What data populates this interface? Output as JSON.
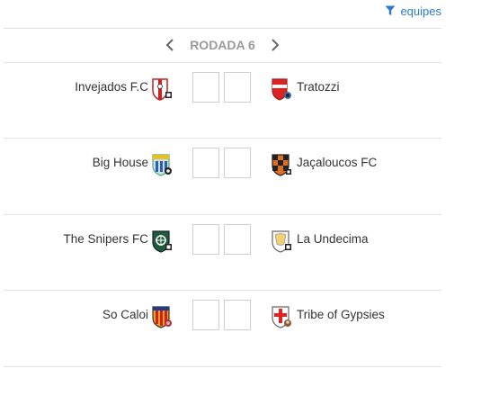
{
  "filter": {
    "label": "equipes",
    "icon": "filter-icon"
  },
  "round": {
    "label": "RODADA 6"
  },
  "matches": [
    {
      "home": "Invejados F.C",
      "away": "Tratozzi",
      "home_score": "",
      "away_score": ""
    },
    {
      "home": "Big House",
      "away": "Jaçaloucos FC",
      "home_score": "",
      "away_score": ""
    },
    {
      "home": "The Snipers FC",
      "away": "La Undecima",
      "home_score": "",
      "away_score": ""
    },
    {
      "home": "So Caloi",
      "away": "Tribe of Gypsies",
      "home_score": "",
      "away_score": ""
    }
  ],
  "colors": {
    "accent": "#2b7bc8",
    "muted": "#9a9a9a",
    "border": "#cfcfcf",
    "divider": "#e2e2e2"
  }
}
